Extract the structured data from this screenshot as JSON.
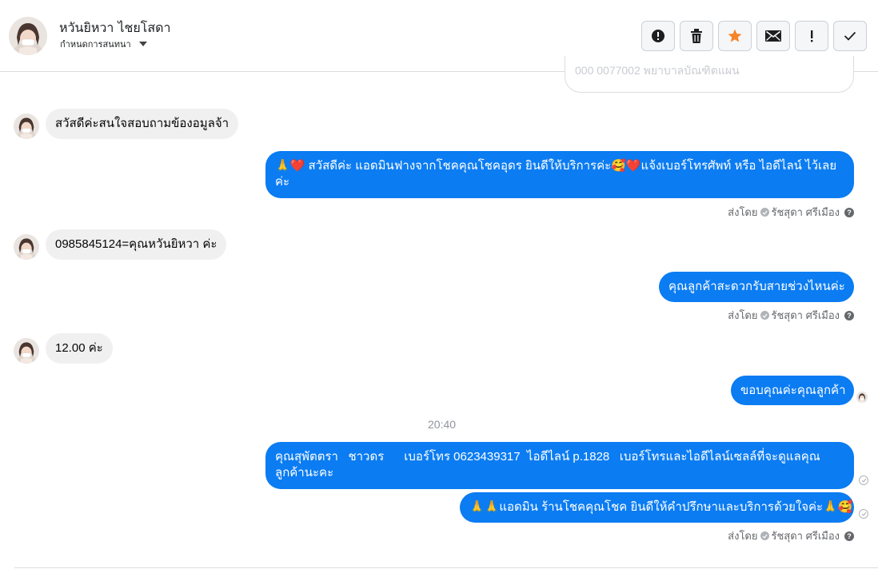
{
  "header": {
    "contact_name": "หวันยิหวา ไชยโสดา",
    "subtitle": "กำหนดการสนทนา",
    "actions": [
      {
        "icon": "alert-circle-icon",
        "label": "report"
      },
      {
        "icon": "trash-icon",
        "label": "delete"
      },
      {
        "icon": "star-icon",
        "label": "star"
      },
      {
        "icon": "envelope-icon",
        "label": "mark-unread"
      },
      {
        "icon": "exclamation-icon",
        "label": "important"
      },
      {
        "icon": "checkmark-icon",
        "label": "done"
      }
    ]
  },
  "previous_bubble_text": "000 0077002 พยาบาลบัณฑิตแผน",
  "messages": [
    {
      "direction": "in",
      "text": "สวัสดีค่ะสนใจสอบถามข้องอมูลจ้า"
    },
    {
      "direction": "out",
      "text": "🙏❤️ สวัสดีค่ะ แอดมินฟางจากโชคคุณโชคอุดร ยินดีให้บริการค่ะ🥰❤️แจ้งเบอร์โทรศัพท์ หรือ ไอดีไลน์  ไว้เลยค่ะ",
      "sent_by": "ส่งโดย",
      "agent": "รัชสุดา ศรีเมือง"
    },
    {
      "direction": "in",
      "text": "0985845124=คุณหวันยิหวา ค่ะ"
    },
    {
      "direction": "out",
      "text": "คุณลูกค้าสะดวกรับสายช่วงไหนค่ะ",
      "sent_by": "ส่งโดย",
      "agent": "รัชสุดา ศรีเมือง"
    },
    {
      "direction": "in",
      "text": "12.00 ค่ะ"
    },
    {
      "direction": "out",
      "text": "ขอบคุณค่ะคุณลูกค้า"
    },
    {
      "direction": "out",
      "text": "คุณสุพัตตรา   ชาวดร      เบอร์โทร 0623439317  ไอดีไลน์ p.1828   เบอร์โทรและไอดีไลน์เซลล์ที่จะดูแลคุณลูกค้านะคะ"
    },
    {
      "direction": "out",
      "text": "🙏🙏แอดมิน ร้านโชคคุณโชค ยินดีให้คำปรึกษาและบริการด้วยใจค่ะ🙏🥰",
      "sent_by": "ส่งโดย",
      "agent": "รัชสุดา ศรีเมือง"
    }
  ],
  "timestamp": "20:40",
  "colors": {
    "outgoing": "#0b7cf2",
    "incoming": "#f0f0f0",
    "star": "#f5842a"
  }
}
